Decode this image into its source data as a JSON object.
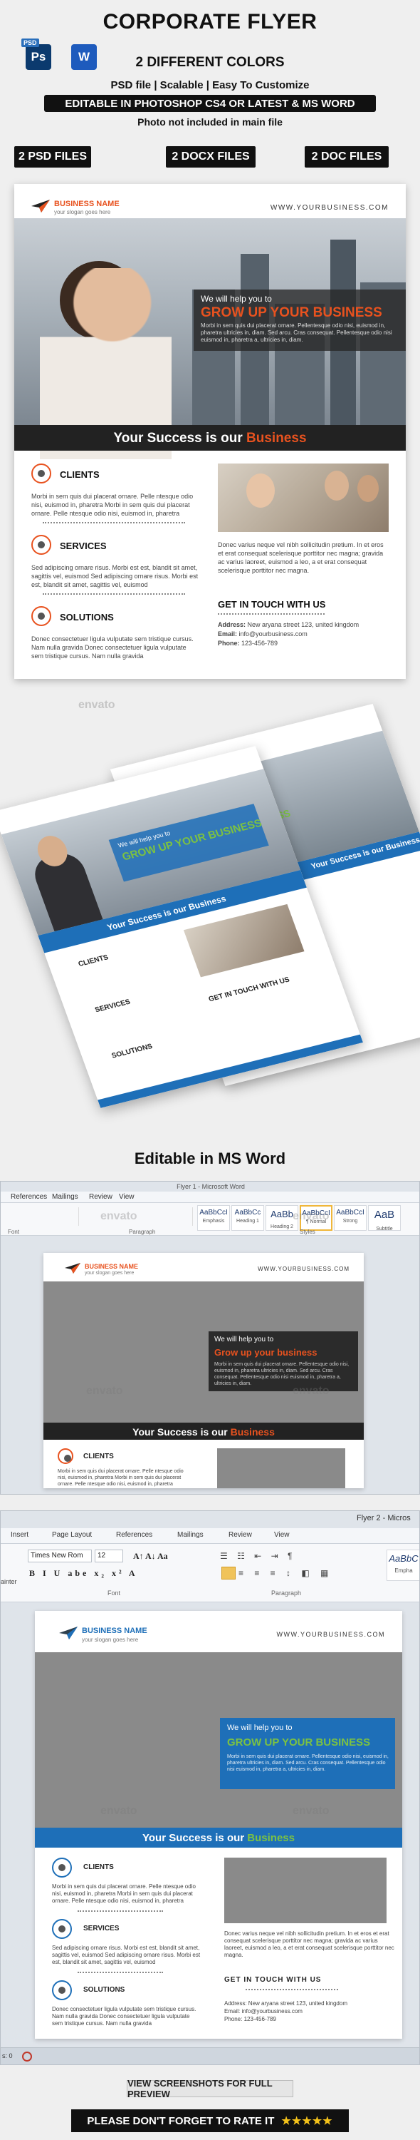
{
  "header": {
    "title": "CORPORATE FLYER",
    "psd_tag": "PSD",
    "psd_icon": "Ps",
    "word_icon": "W",
    "line1": "2 DIFFERENT COLORS",
    "line2": "PSD file  |  Scalable  |  Easy To Customize",
    "line3": "EDITABLE IN PHOTOSHOP CS4 OR LATEST & MS WORD",
    "line4": "Photo not included in main file",
    "badges": [
      "2 PSD FILES",
      "2 DOCX FILES",
      "2 DOC FILES"
    ]
  },
  "flyer": {
    "brand": "BUSINESS NAME",
    "tagline": "your slogan goes here",
    "website": "WWW.YOURBUSINESS.COM",
    "overlay_small": "We will help you to",
    "overlay_big": "GROW UP YOUR BUSINESS",
    "overlay_body": "Morbi in sem quis dui placerat ornare. Pellentesque odio nisi, euismod in, pharetra ultricies in, diam. Sed arcu. Cras consequat. Pellentesque odio nisi euismod in, pharetra a, ultricies in, diam.",
    "bar_text": "Your Success is our ",
    "bar_highlight": "Business",
    "sections": [
      {
        "title": "CLIENTS",
        "body": "Morbi in sem quis dui placerat ornare. Pelle ntesque odio nisi, euismod in, pharetra Morbi in sem quis dui placerat ornare. Pelle ntesque odio nisi, euismod in, pharetra"
      },
      {
        "title": "SERVICES",
        "body": "Sed adipiscing ornare risus. Morbi est est, blandit sit amet, sagittis vel, euismod Sed adipiscing ornare risus. Morbi est est, blandit sit amet, sagittis vel, euismod"
      },
      {
        "title": "SOLUTIONS",
        "body": "Donec consectetuer ligula vulputate sem tristique cursus. Nam nulla gravida Donec consectetuer ligula vulputate sem tristique cursus. Nam nulla gravida"
      }
    ],
    "right_body": "Donec varius neque vel nibh sollicitudin pretium. In et eros et erat consequat scelerisque porttitor nec magna; gravida ac varius laoreet, euismod a leo, a et erat consequat scelerisque porttitor nec magna.",
    "contact_title": "GET IN TOUCH WITH US",
    "contact": {
      "address_label": "Address:",
      "address": "New aryana street 123, united kingdom",
      "email_label": "Email:",
      "email": "info@yourbusiness.com",
      "phone_label": "Phone:",
      "phone": "123-456-789"
    }
  },
  "mockup": {
    "card_title": "GROW UP YOUR BUSINESS",
    "card_small": "We will help you to",
    "card_bar": "Your Success is our Business",
    "contact_title": "GET IN TOUCH WITH US",
    "sections": [
      "CLIENTS",
      "SERVICES",
      "SOLUTIONS"
    ]
  },
  "word_section_title": "Editable in MS Word",
  "word1": {
    "window_title": "Flyer 1 - Microsoft Word",
    "tabs": [
      "References",
      "Mailings",
      "Review",
      "View"
    ],
    "styles": [
      "AaBbCcI",
      "AaBbCc",
      "AaBb",
      "AaBbCcI",
      "AaBbCcI",
      "AaB"
    ],
    "style_names": [
      "Emphasis",
      "Heading 1",
      "Heading 2",
      "¶ Normal",
      "Strong",
      "Subtitle"
    ],
    "group_labels": [
      "Font",
      "Paragraph",
      "Styles"
    ],
    "overlay_small": "We will help you to",
    "overlay_big": "Grow up your business",
    "bar_text": "Your Success is our ",
    "bar_highlight": "Business",
    "section": "CLIENTS"
  },
  "word2": {
    "window_title": "Flyer 2 - Micros",
    "tabs": [
      "Insert",
      "Page Layout",
      "References",
      "Mailings",
      "Review",
      "View"
    ],
    "font_name": "Times New Rom",
    "font_size": "12",
    "group_labels": [
      "Font",
      "Paragraph"
    ],
    "style_preview": "AaBbC",
    "style_name": "Empha",
    "left_cut": "ainter",
    "status_left": "s: 0",
    "overlay_small": "We will help you to",
    "overlay_big": "GROW UP YOUR BUSINESS",
    "bar_text": "Your Success is our ",
    "bar_highlight": "Business",
    "sections": [
      "CLIENTS",
      "SERVICES",
      "SOLUTIONS"
    ],
    "contact_title": "GET IN TOUCH WITH US",
    "address": "Address:   New aryana street 123, united kingdom",
    "email": "Email:   info@yourbusiness.com",
    "phone": "Phone:   123-456-789"
  },
  "watermark": "envato",
  "footer": {
    "preview": "VIEW SCREENSHOTS FOR FULL PREVIEW",
    "rate": "PLEASE DON'T FORGET TO RATE IT",
    "stars": "★★★★★"
  },
  "colors": {
    "accent_orange": "#e8521f",
    "accent_blue": "#1e6fb8",
    "accent_green": "#7cc242",
    "dark": "#222222"
  }
}
